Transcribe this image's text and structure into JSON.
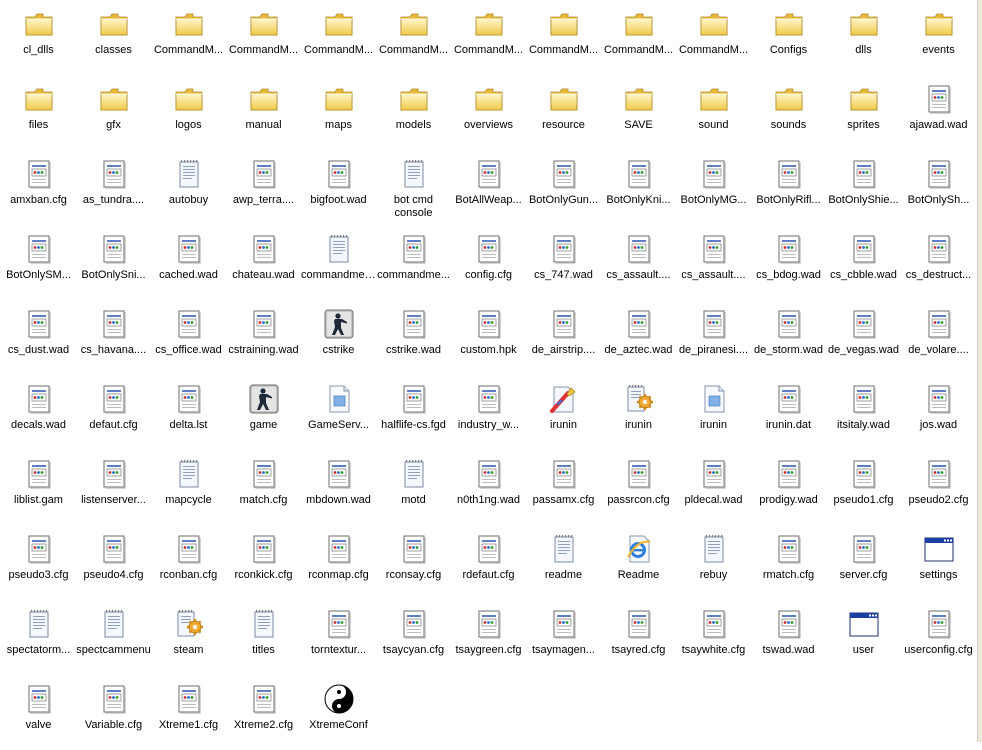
{
  "items": [
    {
      "label": "cl_dlls",
      "type": "folder"
    },
    {
      "label": "classes",
      "type": "folder"
    },
    {
      "label": "CommandM...",
      "type": "folder"
    },
    {
      "label": "CommandM...",
      "type": "folder"
    },
    {
      "label": "CommandM...",
      "type": "folder"
    },
    {
      "label": "CommandM...",
      "type": "folder"
    },
    {
      "label": "CommandM...",
      "type": "folder"
    },
    {
      "label": "CommandM...",
      "type": "folder"
    },
    {
      "label": "CommandM...",
      "type": "folder"
    },
    {
      "label": "CommandM...",
      "type": "folder"
    },
    {
      "label": "Configs",
      "type": "folder"
    },
    {
      "label": "dlls",
      "type": "folder"
    },
    {
      "label": "events",
      "type": "folder"
    },
    {
      "label": "files",
      "type": "folder"
    },
    {
      "label": "gfx",
      "type": "folder"
    },
    {
      "label": "logos",
      "type": "folder"
    },
    {
      "label": "manual",
      "type": "folder"
    },
    {
      "label": "maps",
      "type": "folder"
    },
    {
      "label": "models",
      "type": "folder"
    },
    {
      "label": "overviews",
      "type": "folder"
    },
    {
      "label": "resource",
      "type": "folder"
    },
    {
      "label": "SAVE",
      "type": "folder"
    },
    {
      "label": "sound",
      "type": "folder"
    },
    {
      "label": "sounds",
      "type": "folder"
    },
    {
      "label": "sprites",
      "type": "folder"
    },
    {
      "label": "ajawad.wad",
      "type": "data"
    },
    {
      "label": "amxban.cfg",
      "type": "data"
    },
    {
      "label": "as_tundra....",
      "type": "data"
    },
    {
      "label": "autobuy",
      "type": "text"
    },
    {
      "label": "awp_terra....",
      "type": "data"
    },
    {
      "label": "bigfoot.wad",
      "type": "data"
    },
    {
      "label": "bot cmd console",
      "type": "text",
      "wrap": true
    },
    {
      "label": "BotAllWeap...",
      "type": "data"
    },
    {
      "label": "BotOnlyGun...",
      "type": "data"
    },
    {
      "label": "BotOnlyKni...",
      "type": "data"
    },
    {
      "label": "BotOnlyMG...",
      "type": "data"
    },
    {
      "label": "BotOnlyRifl...",
      "type": "data"
    },
    {
      "label": "BotOnlyShie...",
      "type": "data"
    },
    {
      "label": "BotOnlySh...",
      "type": "data"
    },
    {
      "label": "BotOnlySM...",
      "type": "data"
    },
    {
      "label": "BotOnlySni...",
      "type": "data"
    },
    {
      "label": "cached.wad",
      "type": "data"
    },
    {
      "label": "chateau.wad",
      "type": "data"
    },
    {
      "label": "commandmenu",
      "type": "text"
    },
    {
      "label": "commandme...",
      "type": "data"
    },
    {
      "label": "config.cfg",
      "type": "data"
    },
    {
      "label": "cs_747.wad",
      "type": "data"
    },
    {
      "label": "cs_assault....",
      "type": "data"
    },
    {
      "label": "cs_assault....",
      "type": "data"
    },
    {
      "label": "cs_bdog.wad",
      "type": "data"
    },
    {
      "label": "cs_cbble.wad",
      "type": "data"
    },
    {
      "label": "cs_destruct...",
      "type": "data"
    },
    {
      "label": "cs_dust.wad",
      "type": "data"
    },
    {
      "label": "cs_havana....",
      "type": "data"
    },
    {
      "label": "cs_office.wad",
      "type": "data"
    },
    {
      "label": "cstraining.wad",
      "type": "data"
    },
    {
      "label": "cstrike",
      "type": "cstrike"
    },
    {
      "label": "cstrike.wad",
      "type": "data"
    },
    {
      "label": "custom.hpk",
      "type": "data"
    },
    {
      "label": "de_airstrip....",
      "type": "data"
    },
    {
      "label": "de_aztec.wad",
      "type": "data"
    },
    {
      "label": "de_piranesi....",
      "type": "data"
    },
    {
      "label": "de_storm.wad",
      "type": "data"
    },
    {
      "label": "de_vegas.wad",
      "type": "data"
    },
    {
      "label": "de_volare....",
      "type": "data"
    },
    {
      "label": "decals.wad",
      "type": "data"
    },
    {
      "label": "defaut.cfg",
      "type": "data"
    },
    {
      "label": "delta.lst",
      "type": "data"
    },
    {
      "label": "game",
      "type": "cstrike"
    },
    {
      "label": "GameServ...",
      "type": "blank"
    },
    {
      "label": "halflife-cs.fgd",
      "type": "data"
    },
    {
      "label": "industry_w...",
      "type": "data"
    },
    {
      "label": "irunin",
      "type": "setup"
    },
    {
      "label": "irunin",
      "type": "gearscript"
    },
    {
      "label": "irunin",
      "type": "blank"
    },
    {
      "label": "irunin.dat",
      "type": "data"
    },
    {
      "label": "itsitaly.wad",
      "type": "data"
    },
    {
      "label": "jos.wad",
      "type": "data"
    },
    {
      "label": "liblist.gam",
      "type": "data"
    },
    {
      "label": "listenserver...",
      "type": "data"
    },
    {
      "label": "mapcycle",
      "type": "text"
    },
    {
      "label": "match.cfg",
      "type": "data"
    },
    {
      "label": "mbdown.wad",
      "type": "data"
    },
    {
      "label": "motd",
      "type": "text"
    },
    {
      "label": "n0th1ng.wad",
      "type": "data"
    },
    {
      "label": "passamx.cfg",
      "type": "data"
    },
    {
      "label": "passrcon.cfg",
      "type": "data"
    },
    {
      "label": "pldecal.wad",
      "type": "data"
    },
    {
      "label": "prodigy.wad",
      "type": "data"
    },
    {
      "label": "pseudo1.cfg",
      "type": "data"
    },
    {
      "label": "pseudo2.cfg",
      "type": "data"
    },
    {
      "label": "pseudo3.cfg",
      "type": "data"
    },
    {
      "label": "pseudo4.cfg",
      "type": "data"
    },
    {
      "label": "rconban.cfg",
      "type": "data"
    },
    {
      "label": "rconkick.cfg",
      "type": "data"
    },
    {
      "label": "rconmap.cfg",
      "type": "data"
    },
    {
      "label": "rconsay.cfg",
      "type": "data"
    },
    {
      "label": "rdefaut.cfg",
      "type": "data"
    },
    {
      "label": "readme",
      "type": "text"
    },
    {
      "label": "Readme",
      "type": "ie"
    },
    {
      "label": "rebuy",
      "type": "text"
    },
    {
      "label": "rmatch.cfg",
      "type": "data"
    },
    {
      "label": "server.cfg",
      "type": "data"
    },
    {
      "label": "settings",
      "type": "window"
    },
    {
      "label": "spectatorm...",
      "type": "text"
    },
    {
      "label": "spectcammenu",
      "type": "text"
    },
    {
      "label": "steam",
      "type": "gearscript"
    },
    {
      "label": "titles",
      "type": "text"
    },
    {
      "label": "torntextur...",
      "type": "data"
    },
    {
      "label": "tsaycyan.cfg",
      "type": "data"
    },
    {
      "label": "tsaygreen.cfg",
      "type": "data"
    },
    {
      "label": "tsaymagen...",
      "type": "data"
    },
    {
      "label": "tsayred.cfg",
      "type": "data"
    },
    {
      "label": "tsaywhite.cfg",
      "type": "data"
    },
    {
      "label": "tswad.wad",
      "type": "data"
    },
    {
      "label": "user",
      "type": "window"
    },
    {
      "label": "userconfig.cfg",
      "type": "data"
    },
    {
      "label": "valve",
      "type": "data"
    },
    {
      "label": "Variable.cfg",
      "type": "data"
    },
    {
      "label": "Xtreme1.cfg",
      "type": "data"
    },
    {
      "label": "Xtreme2.cfg",
      "type": "data"
    },
    {
      "label": "XtremeConf",
      "type": "yinyang"
    }
  ]
}
